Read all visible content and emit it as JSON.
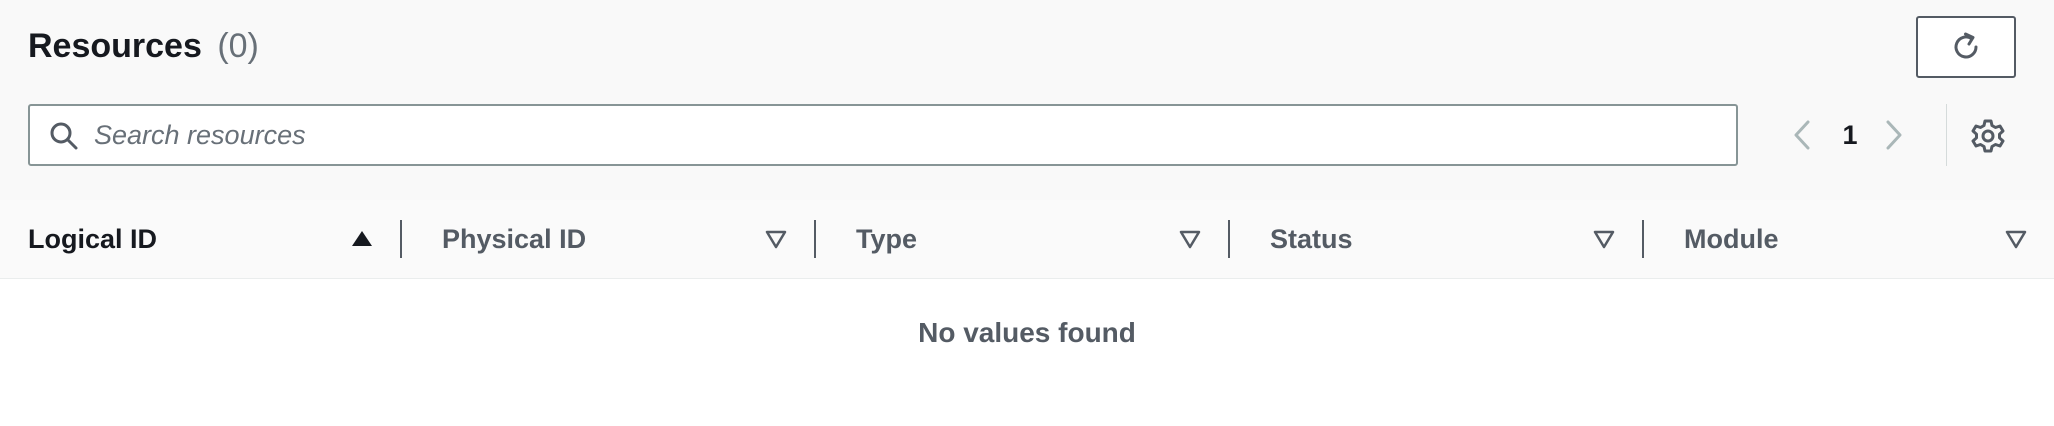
{
  "resources": {
    "title": "Resources",
    "count": "(0)"
  },
  "toolbar": {
    "refresh_icon": "refresh-icon",
    "search": {
      "placeholder": "Search resources",
      "value": "",
      "icon": "search-icon"
    },
    "pagination": {
      "current_page": "1",
      "prev_icon": "chevron-left-icon",
      "next_icon": "chevron-right-icon",
      "prev_enabled": false,
      "next_enabled": false
    },
    "settings_icon": "gear-icon"
  },
  "table": {
    "columns": [
      {
        "label": "Logical ID",
        "sort": "ascending"
      },
      {
        "label": "Physical ID",
        "sort": "none"
      },
      {
        "label": "Type",
        "sort": "none"
      },
      {
        "label": "Status",
        "sort": "none"
      },
      {
        "label": "Module",
        "sort": "none"
      }
    ],
    "rows": [],
    "empty_message": "No values found"
  },
  "colors": {
    "text_primary": "#16191f",
    "text_secondary": "#545b64",
    "text_muted": "#687078",
    "border": "#879596",
    "header_bg": "#f9f9f9",
    "disabled_icon": "#aab7b8"
  }
}
